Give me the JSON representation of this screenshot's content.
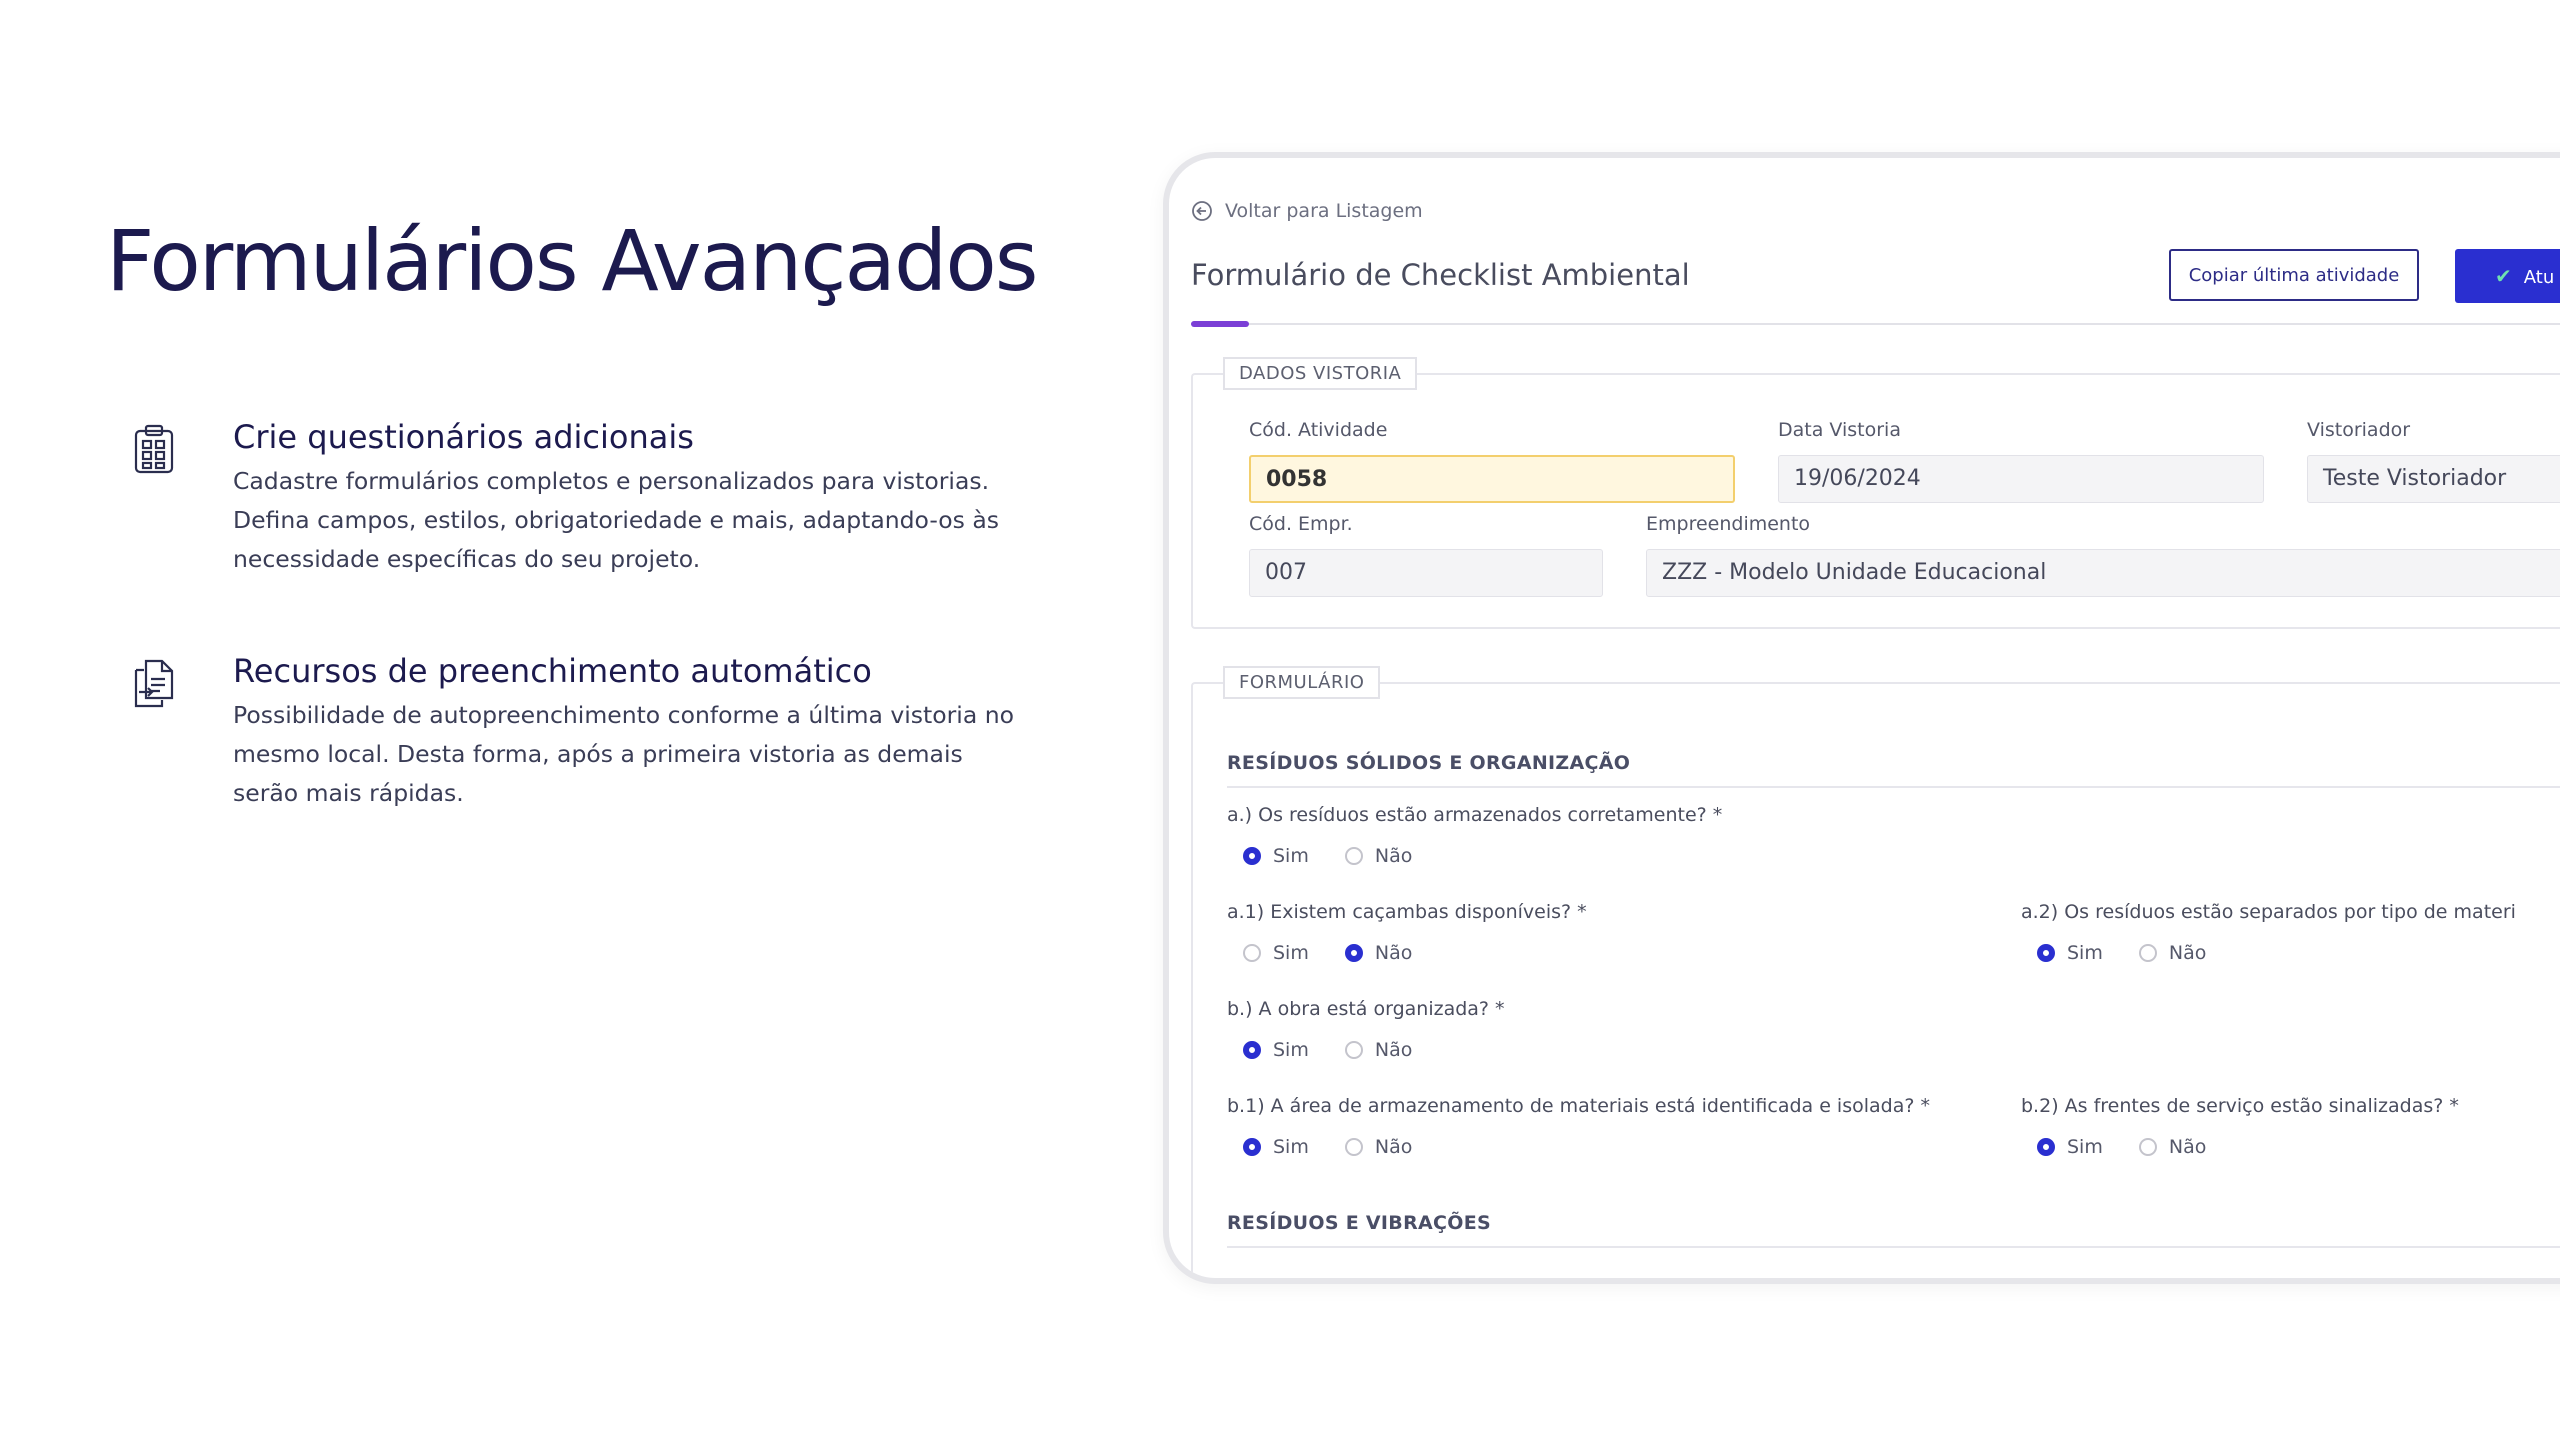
{
  "hero": {
    "title": "Formulários Avançados"
  },
  "features": [
    {
      "icon": "clipboard-icon",
      "title": "Crie questionários adicionais",
      "text": "Cadastre formulários completos e personalizados para vistorias. Defina campos, estilos, obrigatoriedade e mais, adaptando-os às necessidade específicas do seu projeto."
    },
    {
      "icon": "document-transfer-icon",
      "title": "Recursos de preenchimento automático",
      "text": "Possibilidade de autopreenchimento conforme a última vistoria no mesmo local. Desta forma, após a primeira vistoria as demais serão mais rápidas."
    }
  ],
  "app": {
    "back_link": "Voltar para Listagem",
    "form_title": "Formulário de Checklist Ambiental",
    "copy_button": "Copiar última atividade",
    "primary_button": "Atu",
    "accent_color": "#2a2fd0",
    "tab_indicator_color": "#7b3fd6",
    "section1": {
      "legend": "DADOS VISTORIA",
      "fields": {
        "cod_atividade": {
          "label": "Cód. Atividade",
          "value": "0058"
        },
        "data_vistoria": {
          "label": "Data Vistoria",
          "value": "19/06/2024"
        },
        "vistoriador": {
          "label": "Vistoriador",
          "value": "Teste Vistoriador"
        },
        "cod_empr": {
          "label": "Cód. Empr.",
          "value": "007"
        },
        "empreendimento": {
          "label": "Empreendimento",
          "value": "ZZZ - Modelo Unidade Educacional"
        }
      }
    },
    "section2": {
      "legend": "FORMULÁRIO",
      "category1": "RESÍDUOS SÓLIDOS E ORGANIZAÇÃO",
      "category2": "RESÍDUOS E VIBRAÇÕES",
      "option_yes": "Sim",
      "option_no": "Não",
      "questions": {
        "a": {
          "text": "a.) Os resíduos estão armazenados corretamente? *",
          "selected": "Sim"
        },
        "a1": {
          "text": "a.1) Existem caçambas disponíveis? *",
          "selected": "Não"
        },
        "a2": {
          "text": "a.2) Os resíduos estão separados por tipo de materi",
          "selected": "Sim"
        },
        "b": {
          "text": "b.) A obra está organizada? *",
          "selected": "Sim"
        },
        "b1": {
          "text": "b.1) A área de armazenamento de materiais está identificada e isolada? *",
          "selected": "Sim"
        },
        "b2": {
          "text": "b.2) As frentes de serviço estão sinalizadas? *",
          "selected": "Sim"
        }
      }
    }
  }
}
